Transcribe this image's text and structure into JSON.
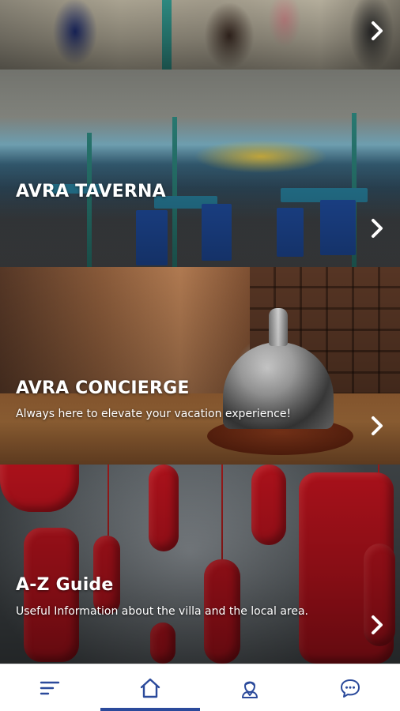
{
  "cards": [
    {
      "id": "top",
      "title": "",
      "subtitle": ""
    },
    {
      "id": "taverna",
      "title": "AVRA TAVERNA",
      "subtitle": ""
    },
    {
      "id": "concierge",
      "title": "AVRA CONCIERGE",
      "subtitle": "Always here to elevate your vacation experience!"
    },
    {
      "id": "guide",
      "title": "A-Z Guide",
      "subtitle": "Useful Information about the villa and the local area."
    }
  ],
  "nav": {
    "items": [
      {
        "icon": "menu-icon",
        "active": false
      },
      {
        "icon": "home-icon",
        "active": true
      },
      {
        "icon": "concierge-person-icon",
        "active": false
      },
      {
        "icon": "chat-bubble-icon",
        "active": false
      }
    ]
  },
  "colors": {
    "brand": "#2b4a9b",
    "nav_icon": "#2b4a9b",
    "card_text": "#ffffff",
    "nav_background": "#ffffff"
  }
}
